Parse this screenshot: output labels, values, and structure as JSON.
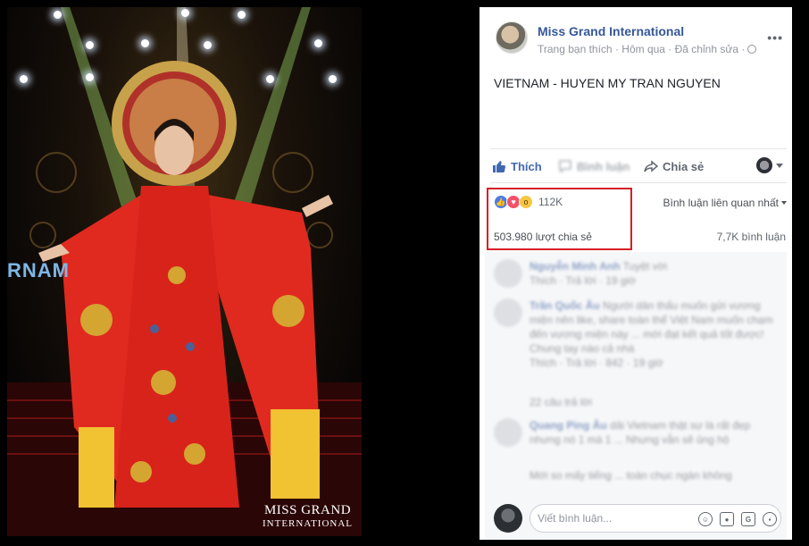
{
  "photo": {
    "screen_text": "RNAM",
    "logo": {
      "main": "MISS GRAND",
      "sub": "INTERNATIONAL"
    }
  },
  "post": {
    "page_name": "Miss Grand International",
    "meta": "Trang bạn thích · Hôm qua · Đã chỉnh sửa ·",
    "text": "VIETNAM - HUYEN MY TRAN NGUYEN"
  },
  "actions": {
    "like": "Thích",
    "comment": "Bình luận",
    "share": "Chia sẻ"
  },
  "stats": {
    "reactions_count": "112K",
    "relevant_label": "Bình luận liên quan nhất",
    "shares": "503.980 lượt chia sẻ",
    "comments": "7,7K bình luận"
  },
  "comments": [
    {
      "author": "Nguyễn Minh Anh",
      "text": "Tuyệt vời",
      "meta": "Thích · Trả lời · 19 giờ"
    },
    {
      "author": "Trần Quốc Âu",
      "text": "Người dân thấu muốn gửi vương miện nên like, share toàn thể Việt Nam muốn chạm đến vương miện này ... mới đạt kết quả tốt được! Chung tay nào cả nhà",
      "meta": "Thích · Trả lời · 842 · 19 giờ"
    },
    {
      "author": "",
      "text": "22 câu trả lời",
      "meta": ""
    },
    {
      "author": "Quang Ping Âu",
      "text": "dải Vietnam thật sự là rất đẹp nhưng nó 1 mà 1 ... Nhưng vẫn sẽ ủng hộ",
      "meta": ""
    },
    {
      "author": "",
      "text": "Mới so mấy tiếng ... toàn chục ngàn không",
      "meta": ""
    }
  ],
  "composer": {
    "placeholder": "Viết bình luận..."
  },
  "colors": {
    "link": "#365899",
    "like_blue": "#4267b2",
    "highlight_red": "#d61f26"
  }
}
